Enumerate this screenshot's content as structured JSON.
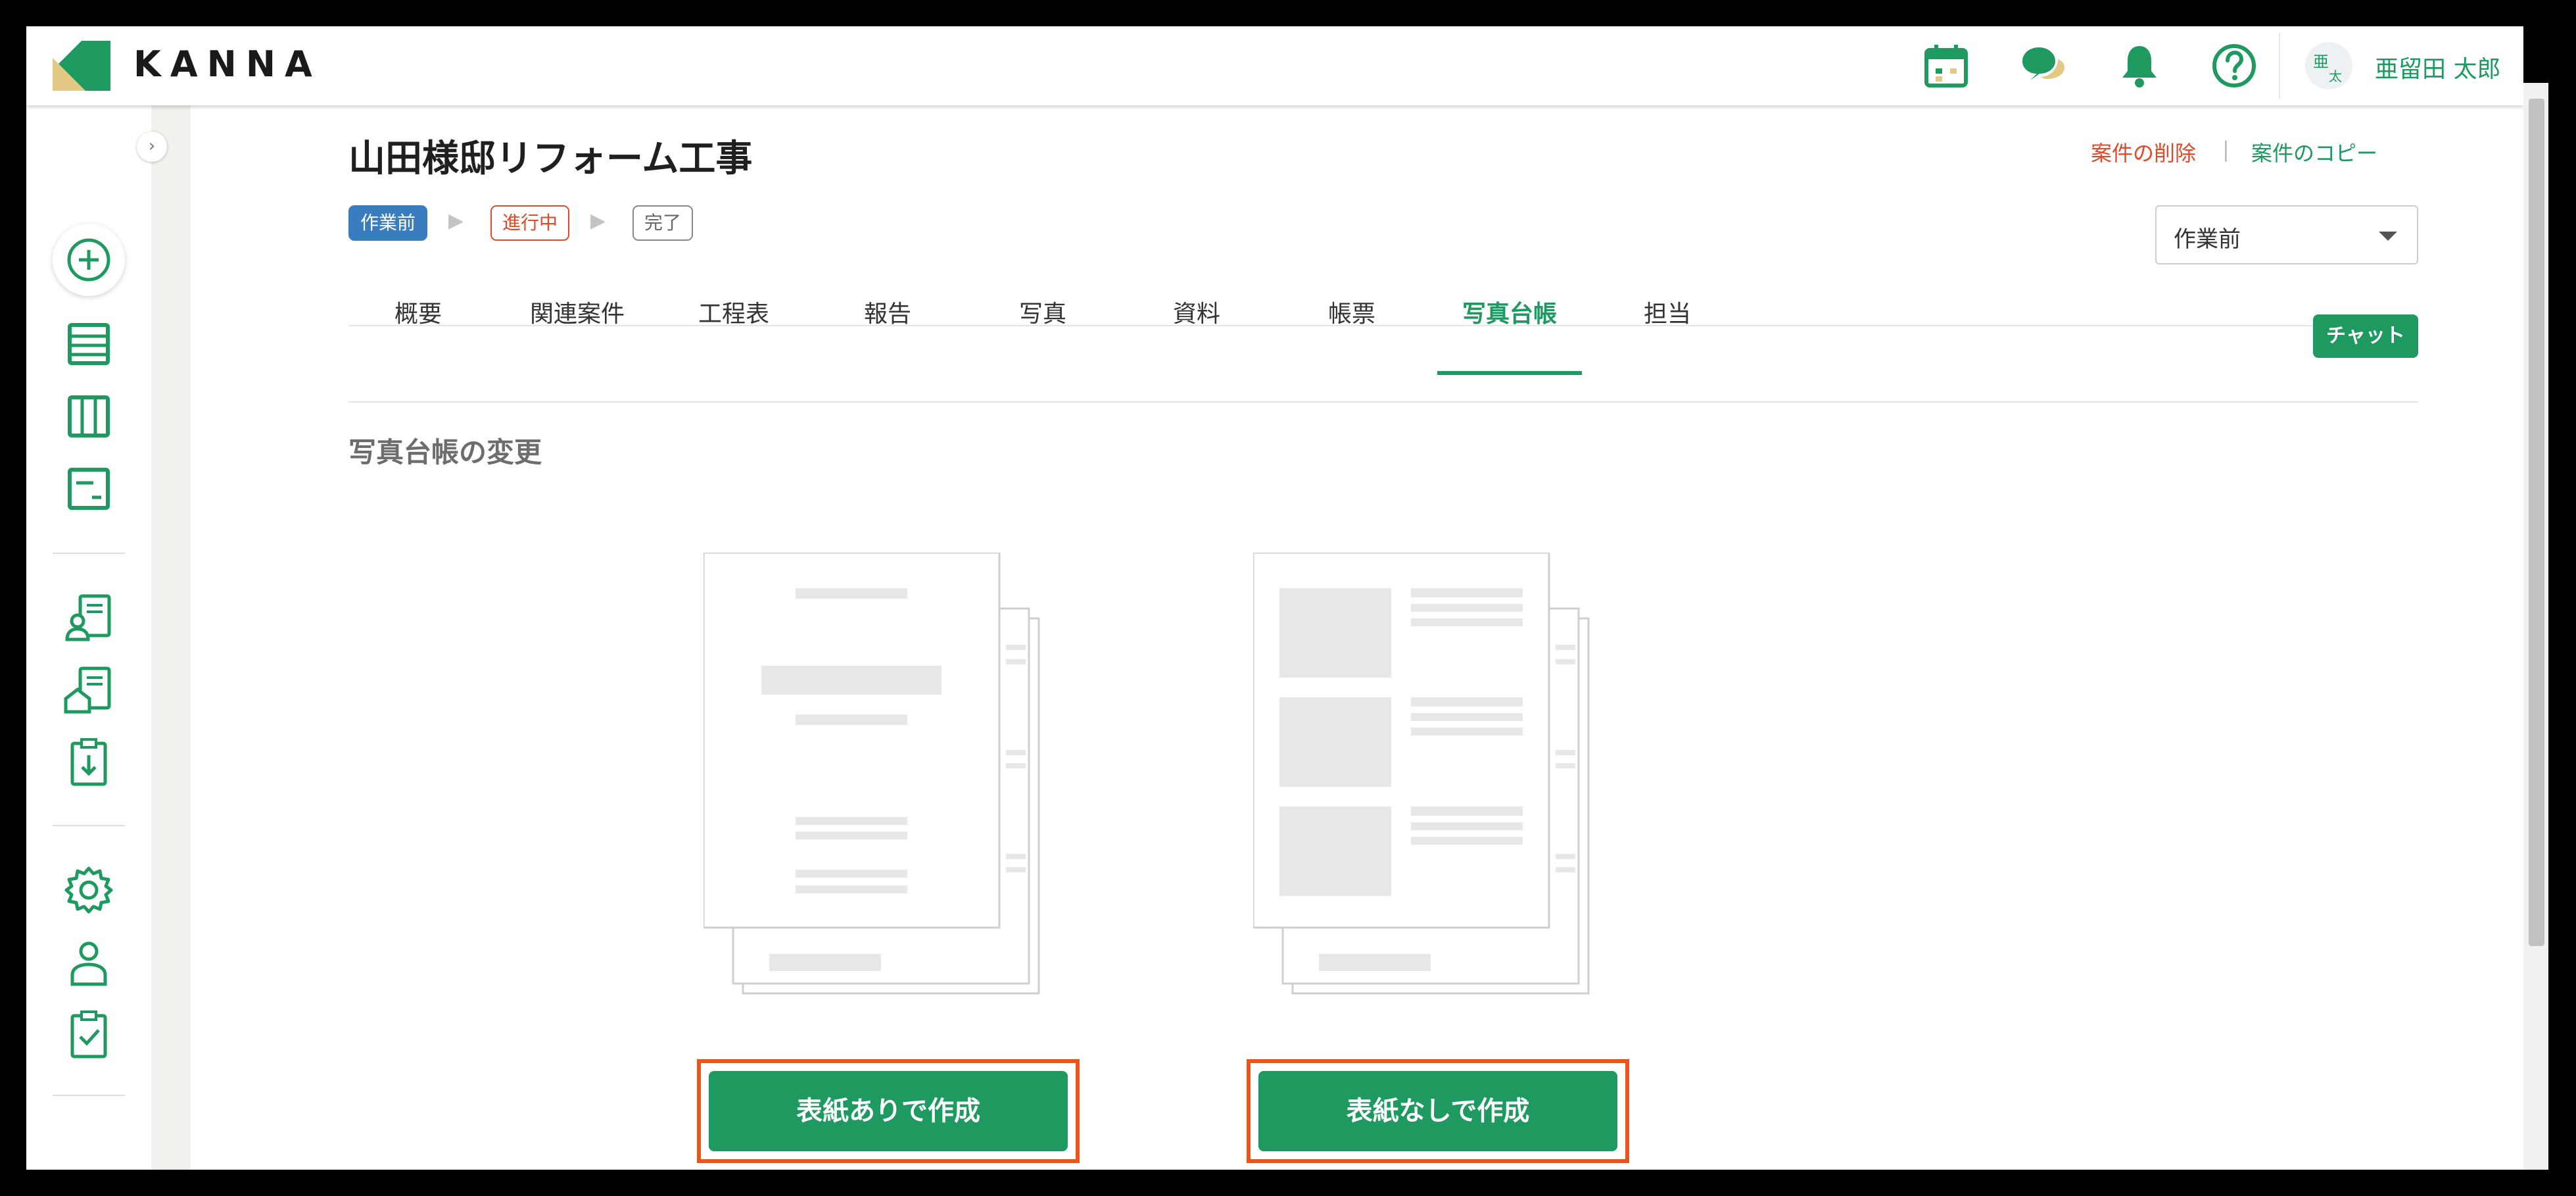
{
  "header": {
    "logo_text": "KANNA",
    "avatar_initials": [
      "亜",
      "太"
    ],
    "user_name": "亜留田 太郎",
    "icons": [
      "calendar-icon",
      "chat-bubbles-icon",
      "bell-icon",
      "help-icon"
    ]
  },
  "sidebar": {
    "collapse_glyph": "›",
    "icons": [
      "add-icon",
      "list-icon",
      "board-icon",
      "gantt-icon",
      "client-document-icon",
      "property-document-icon",
      "clipboard-download-icon",
      "settings-icon",
      "user-icon",
      "clipboard-check-icon"
    ]
  },
  "project": {
    "title": "山田様邸リフォーム工事",
    "delete_link": "案件の削除",
    "separator": "|",
    "copy_link": "案件のコピー",
    "statuses": [
      "作業前",
      "進行中",
      "完了"
    ],
    "status_arrow": "▶",
    "status_select": "作業前"
  },
  "tabs": [
    {
      "label": "概要"
    },
    {
      "label": "関連案件"
    },
    {
      "label": "工程表"
    },
    {
      "label": "報告"
    },
    {
      "label": "写真"
    },
    {
      "label": "資料"
    },
    {
      "label": "帳票"
    },
    {
      "label": "写真台帳"
    },
    {
      "label": "担当"
    }
  ],
  "active_tab": "写真台帳",
  "chat_button": "チャット",
  "section": {
    "title": "写真台帳の変更",
    "with_cover_button": "表紙ありで作成",
    "without_cover_button": "表紙なしで作成"
  },
  "colors": {
    "brand_green": "#1e9a60",
    "danger": "#e0492a",
    "status_blue": "#3a7dbf",
    "highlight_orange": "#e8561c"
  }
}
